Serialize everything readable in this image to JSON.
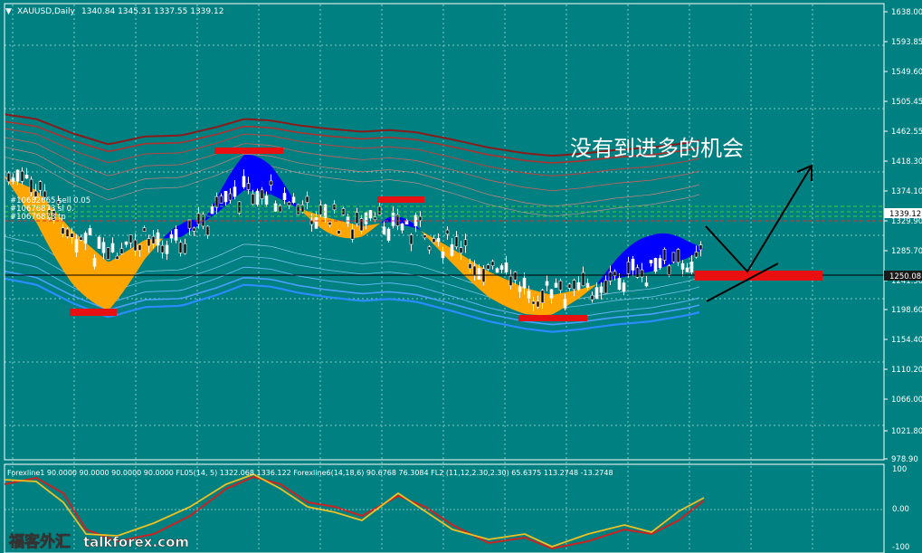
{
  "header": {
    "menu_glyph": "▼",
    "title": "XAUUSD,Daily",
    "ohlc": "1340.84 1345.31 1337.55 1339.12"
  },
  "orders": [
    "#10682665 sell 0.05",
    "#10676873 sl 0.",
    "#10676873 tp"
  ],
  "annotation": "没有到进多的机会",
  "price_axis": {
    "ticks": [
      "1638.00",
      "1593.85",
      "1549.60",
      "1505.45",
      "1462.55",
      "1418.30",
      "1374.10",
      "1329.90",
      "1285.70",
      "1241.50",
      "1198.60",
      "1154.40",
      "1110.20",
      "1066.00",
      "1021.80",
      "978.90"
    ],
    "current_price": "1339.12",
    "hline_price": "1250.08"
  },
  "indicator": {
    "label": "Forexline1 90.0000 90.0000 90.0000 90.0000  FL05(14, 5) 1322.068 1336.122  Forexline6(14,18,6) 90.6768 76.3084  FL2 (11,12,2.30,2.30) 65.6375 113.2748 -13.2748",
    "ticks": [
      "100",
      "0.00",
      "-100"
    ]
  },
  "watermark": {
    "text_cn": "福客外汇",
    "text_en": "talkforex.com"
  },
  "colors": {
    "background": "#008080",
    "grid": "#9fd4d4",
    "cloud_up": "#0000ff",
    "cloud_down": "#ffa500",
    "red_band": "#8b1a1a",
    "blue_band": "#3399ff",
    "marker": "#e81010",
    "ma_red": "#cc2222",
    "ma_yellow": "#f0c020"
  }
}
